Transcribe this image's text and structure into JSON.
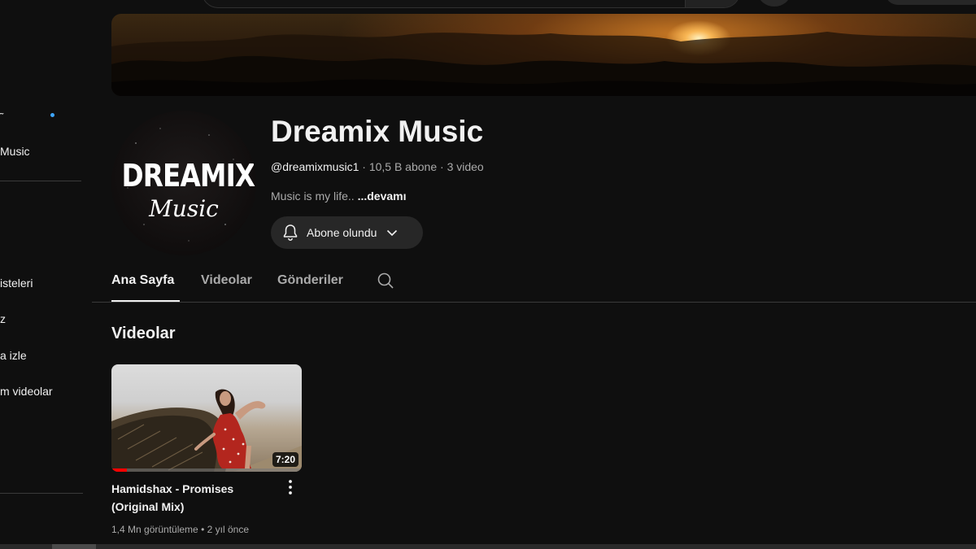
{
  "sidebar": {
    "items": [
      {
        "label": "Music"
      },
      {
        "label": "isteleri"
      },
      {
        "label": "z"
      },
      {
        "label": "a izle"
      },
      {
        "label": "m videolar"
      }
    ],
    "tick_glyph": "˜"
  },
  "channel": {
    "name": "Dreamix Music",
    "handle": "@dreamixmusic1",
    "subscribers": "10,5 B abone",
    "video_count": "3 video",
    "description": "Music is my life..",
    "more_label": "...devamı",
    "avatar_line1": "DREAMIX",
    "avatar_line2": "Music"
  },
  "subscribe_button": {
    "label": "Abone olundu",
    "icon": "bell-icon"
  },
  "tabs": [
    {
      "label": "Ana Sayfa",
      "active": true
    },
    {
      "label": "Videolar",
      "active": false
    },
    {
      "label": "Gönderiler",
      "active": false
    }
  ],
  "section": {
    "title": "Videolar"
  },
  "videos": [
    {
      "title_line1": "Hamidshax - Promises",
      "title_line2": "(Original Mix)",
      "duration": "7:20",
      "views": "1,4 Mn görüntüleme",
      "age": "2 yıl önce",
      "watched_fraction": 0.08
    }
  ],
  "colors": {
    "background": "#0f0f0f",
    "accent_red": "#ff0000",
    "unread_dot": "#3ea6ff"
  }
}
